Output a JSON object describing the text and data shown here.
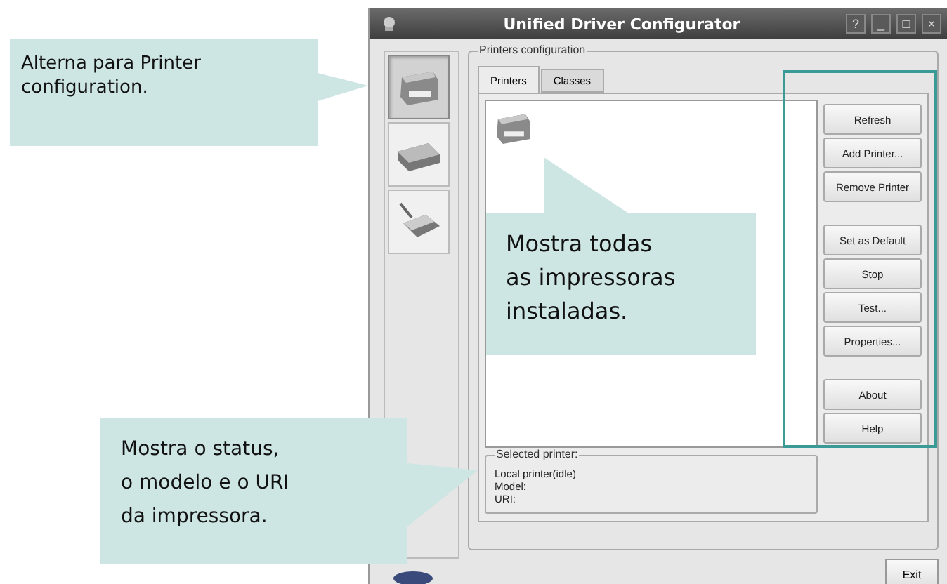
{
  "window": {
    "title": "Unified Driver Configurator",
    "controls": [
      "?",
      "_",
      "□",
      "×"
    ]
  },
  "sidebar": {
    "items": [
      {
        "kind": "printer",
        "selected": true
      },
      {
        "kind": "scanner",
        "selected": false
      },
      {
        "kind": "port",
        "selected": false
      }
    ]
  },
  "printers_configuration": {
    "label": "Printers configuration",
    "tabs": [
      {
        "label": "Printers",
        "selected": true
      },
      {
        "label": "Classes",
        "selected": false
      }
    ],
    "button_groups": [
      [
        "Refresh",
        "Add Printer...",
        "Remove Printer"
      ],
      [
        "Set as Default",
        "Stop",
        "Test...",
        "Properties..."
      ],
      [
        "About",
        "Help"
      ]
    ],
    "selected_printer": {
      "label": "Selected printer:",
      "lines": [
        "Local printer(idle)",
        "Model:",
        "URI:"
      ]
    }
  },
  "exit_button": "Exit",
  "callouts": [
    {
      "text": "Alterna para Printer\nconfiguration."
    },
    {
      "text": "Mostra todas\nas impressoras\ninstaladas."
    },
    {
      "text": "Mostra o status,\no modelo e o URI\nda impressora."
    }
  ]
}
